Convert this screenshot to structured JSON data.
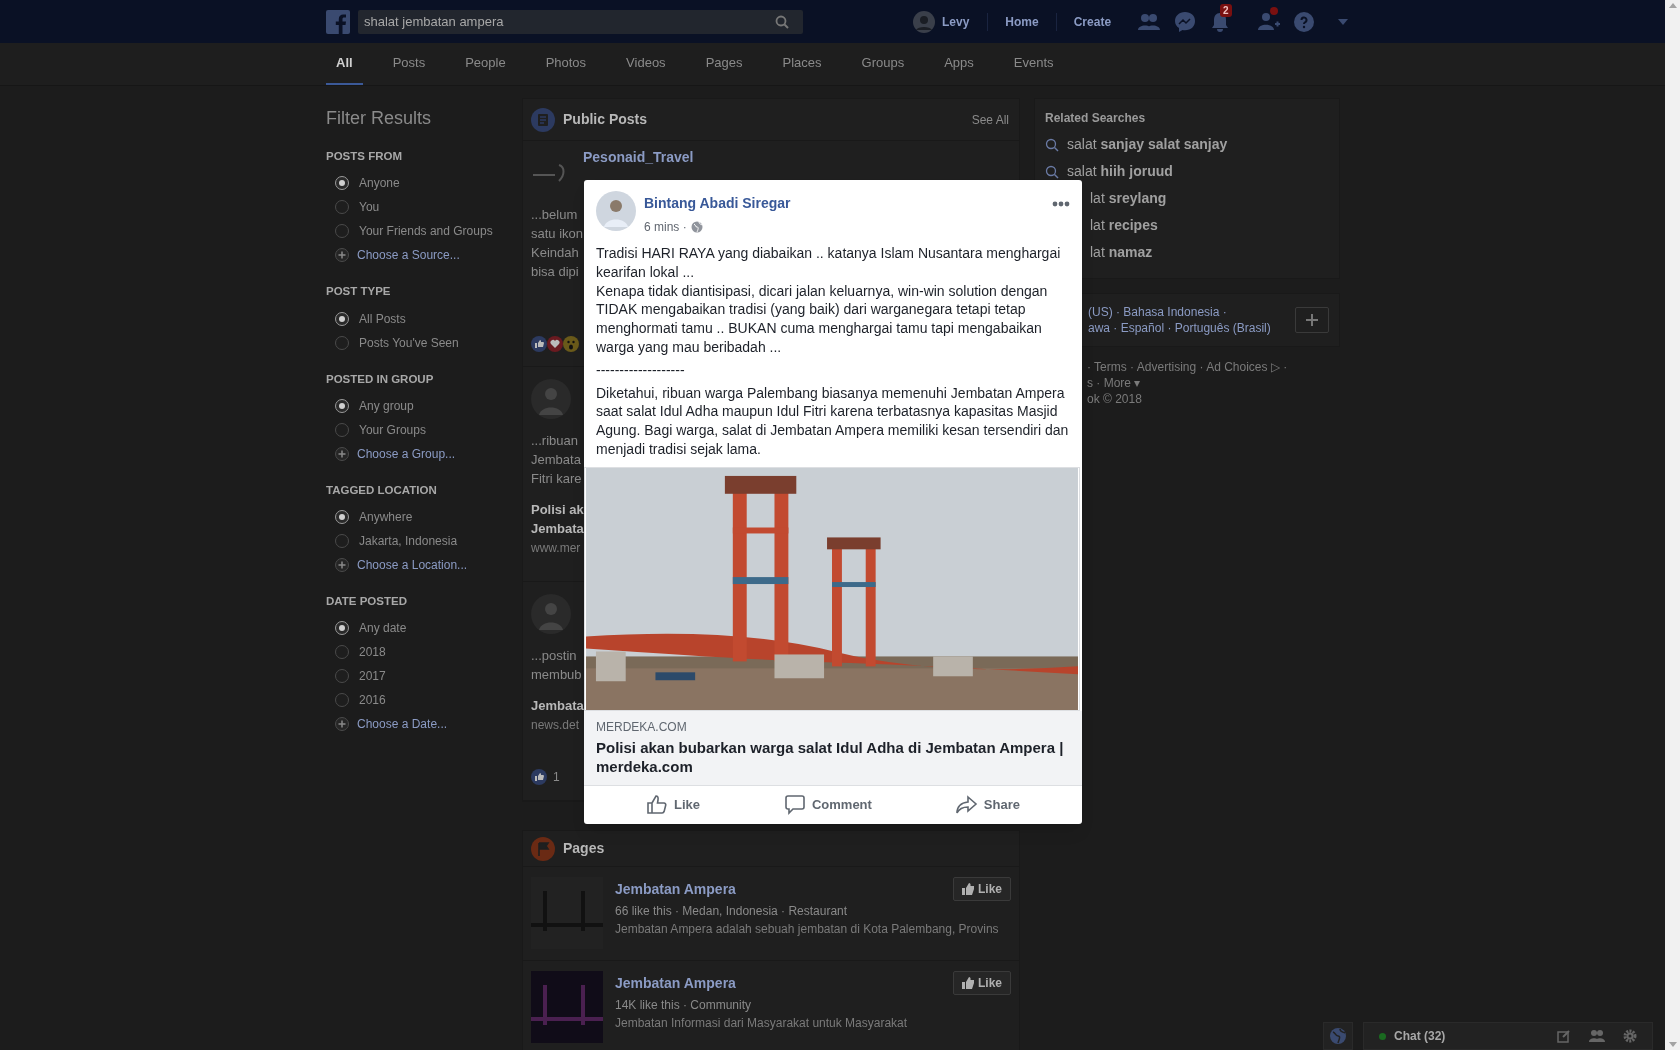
{
  "top_bar": {
    "search": {
      "value": "shalat jembatan ampera"
    },
    "profile_name": "Levy",
    "nav_links": [
      "Home",
      "Create"
    ],
    "notification_count": "2",
    "friend_request_badge": true
  },
  "tabs": [
    {
      "label": "All",
      "selected": true
    },
    {
      "label": "Posts",
      "selected": false
    },
    {
      "label": "People",
      "selected": false
    },
    {
      "label": "Photos",
      "selected": false
    },
    {
      "label": "Videos",
      "selected": false
    },
    {
      "label": "Pages",
      "selected": false
    },
    {
      "label": "Places",
      "selected": false
    },
    {
      "label": "Groups",
      "selected": false
    },
    {
      "label": "Apps",
      "selected": false
    },
    {
      "label": "Events",
      "selected": false
    }
  ],
  "filter_results": {
    "title": "Filter Results",
    "sections": [
      {
        "heading": "POSTS FROM",
        "options": [
          {
            "label": "Anyone",
            "kind": "radio",
            "selected": true
          },
          {
            "label": "You",
            "kind": "radio",
            "selected": false
          },
          {
            "label": "Your Friends and Groups",
            "kind": "radio",
            "selected": false
          },
          {
            "label": "Choose a Source...",
            "kind": "add"
          }
        ]
      },
      {
        "heading": "POST TYPE",
        "options": [
          {
            "label": "All Posts",
            "kind": "radio",
            "selected": true
          },
          {
            "label": "Posts You've Seen",
            "kind": "radio",
            "selected": false
          }
        ]
      },
      {
        "heading": "POSTED IN GROUP",
        "options": [
          {
            "label": "Any group",
            "kind": "radio",
            "selected": true
          },
          {
            "label": "Your Groups",
            "kind": "radio",
            "selected": false
          },
          {
            "label": "Choose a Group...",
            "kind": "add"
          }
        ]
      },
      {
        "heading": "TAGGED LOCATION",
        "options": [
          {
            "label": "Anywhere",
            "kind": "radio",
            "selected": true
          },
          {
            "label": "Jakarta, Indonesia",
            "kind": "radio",
            "selected": false
          },
          {
            "label": "Choose a Location...",
            "kind": "add"
          }
        ]
      },
      {
        "heading": "DATE POSTED",
        "options": [
          {
            "label": "Any date",
            "kind": "radio",
            "selected": true
          },
          {
            "label": "2018",
            "kind": "radio",
            "selected": false
          },
          {
            "label": "2017",
            "kind": "radio",
            "selected": false
          },
          {
            "label": "2016",
            "kind": "radio",
            "selected": false
          },
          {
            "label": "Choose a Date...",
            "kind": "add"
          }
        ]
      }
    ]
  },
  "public_posts": {
    "title": "Public Posts",
    "see_all": "See All",
    "results": [
      {
        "kind": "logo",
        "author": "Pesonaid_Travel",
        "snippet": [
          "...belum",
          "satu ikon",
          "Keindah",
          "bisa dipi"
        ],
        "reactions": [
          {
            "kind": "like"
          },
          {
            "kind": "love"
          },
          {
            "kind": "wow"
          }
        ]
      },
      {
        "kind": "photo",
        "snippet": [
          "...ribuan",
          "Jembata",
          "Fitri kare"
        ],
        "link_title": [
          "Polisi ak",
          "Jembata"
        ],
        "link_domain": "www.mer"
      },
      {
        "kind": "photo",
        "snippet": [
          "...postin",
          "membub"
        ],
        "link_title": [
          "Jembata"
        ],
        "link_domain": "news.det",
        "reactions": [
          {
            "kind": "like"
          }
        ],
        "reaction_count": "1"
      }
    ]
  },
  "pages": {
    "title": "Pages",
    "items": [
      {
        "name": "Jembatan Ampera",
        "meta": "66 like this · Medan, Indonesia · Restaurant",
        "description": "Jembatan Ampera adalah sebuah jembatan di Kota Palembang, Provins",
        "like_label": "Like"
      },
      {
        "name": "Jembatan Ampera",
        "meta": "14K like this · Community",
        "description": "Jembatan Informasi dari Masyarakat untuk Masyarakat",
        "like_label": "Like"
      }
    ]
  },
  "related_searches": {
    "title": "Related Searches",
    "items": [
      {
        "text": "salat **sanjay salat sanjay**",
        "kind": "full"
      },
      {
        "text": "salat **hiih joruud**",
        "kind": "full"
      },
      {
        "text": "lat **sreylang**",
        "kind": "partial"
      },
      {
        "text": "lat **recipes**",
        "kind": "partial"
      },
      {
        "text": "lat **namaz**",
        "kind": "partial"
      }
    ]
  },
  "footer": {
    "languages": [
      "(US) · Bahasa Indonesia ·",
      "awa · Español · Português (Brasil)"
    ],
    "links": [
      "· Terms · Advertising · Ad Choices ▷ ·",
      "s · More ▾",
      "ok © 2018"
    ]
  },
  "post_modal": {
    "author": "Bintang Abadi Siregar",
    "time": "6 mins ·",
    "paragraphs": [
      "Tradisi HARI RAYA yang diabaikan .. katanya Islam Nusantara menghargai kearifan lokal ...\nKenapa tidak diantisipasi, dicari jalan keluarnya, win-win solution dengan TIDAK mengabaikan tradisi (yang baik) dari warganegara tetapi tetap menghormati tamu .. BUKAN cuma menghargai tamu tapi mengabaikan warga yang mau beribadah ...",
      "-------------------",
      "Diketahui, ribuan warga Palembang biasanya memenuhi Jembatan Ampera saat salat Idul Adha maupun Idul Fitri karena terbatasnya kapasitas Masjid Agung. Bagi warga, salat di Jembatan Ampera memiliki kesan tersendiri dan menjadi tradisi sejak lama."
    ],
    "link": {
      "domain": "MERDEKA.COM",
      "title": "Polisi akan bubarkan warga salat Idul Adha di Jembatan Ampera | merdeka.com"
    },
    "actions": [
      {
        "label": "Like",
        "kind": "like"
      },
      {
        "label": "Comment",
        "kind": "comment"
      },
      {
        "label": "Share",
        "kind": "share"
      }
    ]
  },
  "chat": {
    "label": "Chat (32)",
    "online": true
  }
}
